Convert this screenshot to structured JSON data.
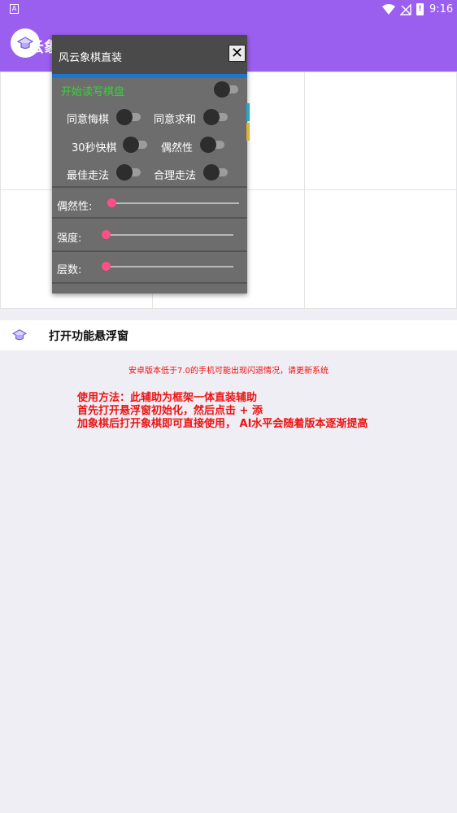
{
  "status": {
    "time": "9:16",
    "battery_text": "!"
  },
  "app": {
    "title": "云象"
  },
  "function_row": {
    "label": "打开功能悬浮窗"
  },
  "warning": "安卓版本低于7.0的手机可能出现闪退情况，请更新系统",
  "instructions": [
    "使用方法：此辅助为框架一体直装辅助",
    "首先打开悬浮窗初始化，然后点击 + 添",
    "加象棋后打开象棋即可直接使用，  AI水平会随着版本逐渐提高"
  ],
  "float_window": {
    "title": "风云象棋直装",
    "close_label": "✕",
    "main_toggle": {
      "label": "开始读写棋盘",
      "on": false
    },
    "toggles": [
      {
        "label": "同意悔棋",
        "on": false
      },
      {
        "label": "同意求和",
        "on": false
      },
      {
        "label": "30秒快棋",
        "on": false
      },
      {
        "label": "偶然性",
        "on": false
      },
      {
        "label": "最佳走法",
        "on": false
      },
      {
        "label": "合理走法",
        "on": false
      }
    ],
    "sliders": [
      {
        "label": "偶然性:",
        "value": 0
      },
      {
        "label": "强度:",
        "value": 0
      },
      {
        "label": "层数:",
        "value": 0
      }
    ]
  },
  "colors": {
    "accent": "#9b5ff0",
    "slider_thumb": "#ff4f86",
    "warning": "#ee1111",
    "toggle_label_green": "#35d43a"
  }
}
